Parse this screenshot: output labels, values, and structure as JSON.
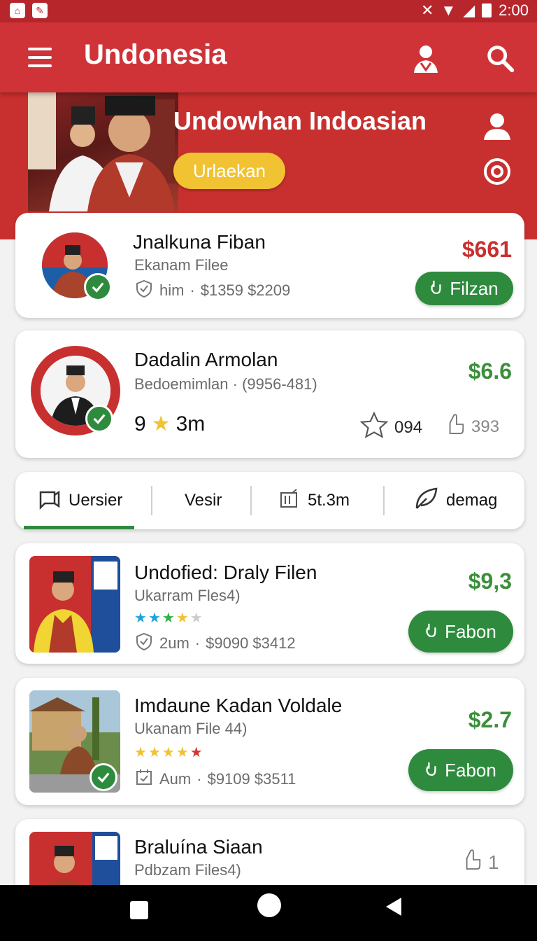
{
  "status_bar": {
    "time": "2:00"
  },
  "app_bar": {
    "title": "Undonesia"
  },
  "hero": {
    "title": "Undowhan Indoasian",
    "pill_label": "Urlaekan"
  },
  "cards": [
    {
      "name": "Jnalkuna Fiban",
      "subtitle": "Ekanam Filee",
      "meta_time": "him",
      "meta_values": "$1359  $2209",
      "price": "$661",
      "button_label": "Filzan",
      "price_color": "#c8302f"
    },
    {
      "name": "Dadalin Armolan",
      "subtitle": "Bedoemimlan · (9956-481)",
      "rating_text_left": "9",
      "rating_text_right": "3m",
      "star_count": "094",
      "thumb_count": "393",
      "price": "$6.6",
      "price_color": "#3b8f3b"
    }
  ],
  "tabs": [
    {
      "label": "Uersier"
    },
    {
      "label": "Vesir"
    },
    {
      "label": "5t.3m"
    },
    {
      "label": "demag"
    }
  ],
  "list": [
    {
      "name": "Undofied: Draly Filen",
      "subtitle": "Ukarram Fles4)",
      "meta_time": "2um",
      "meta_values": "$9090  $3412",
      "price": "$9,3",
      "button_label": "Fabon",
      "rating": 4
    },
    {
      "name": "Imdaune Kadan Voldale",
      "subtitle": "Ukanam File 44)",
      "meta_time": "Aum",
      "meta_values": "$9109  $3511",
      "price": "$2.7",
      "button_label": "Fabon",
      "rating": 5
    },
    {
      "name": "Braluína Siaan",
      "subtitle": "Pdbzam Files4)",
      "count": "1"
    }
  ],
  "colors": {
    "primary": "#cf3338",
    "accent_green": "#2e8b3e",
    "pill_yellow": "#f1c232"
  }
}
